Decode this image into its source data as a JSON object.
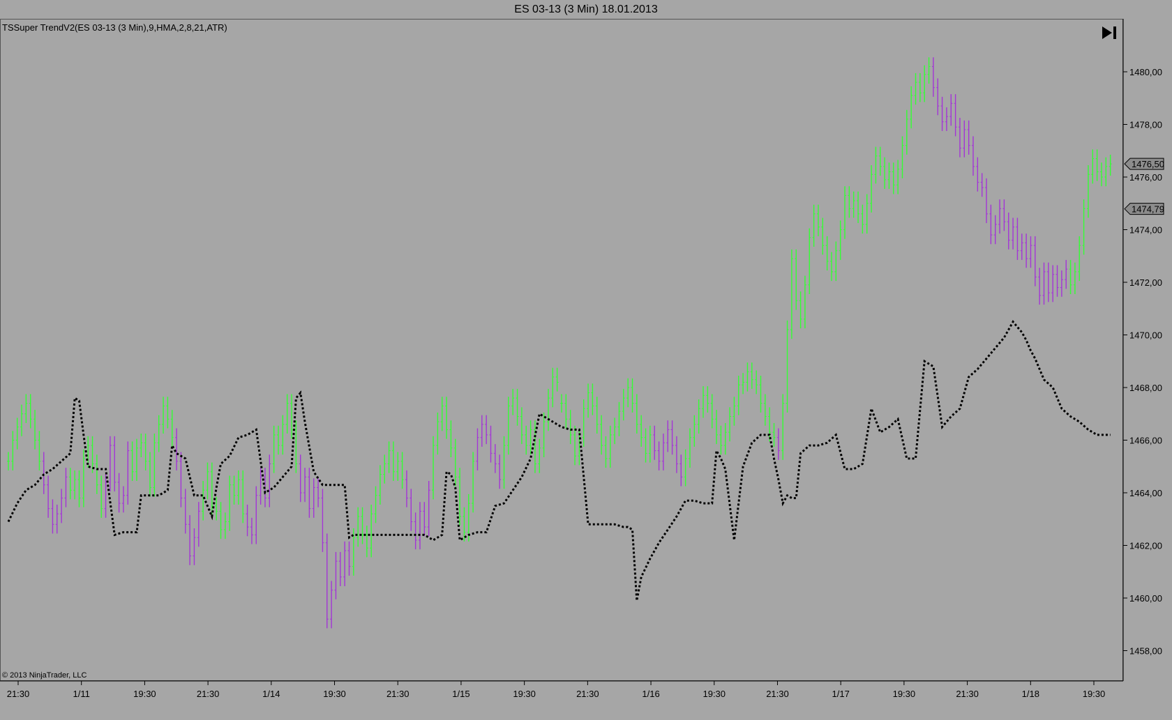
{
  "window": {
    "title": "ES 03-13 (3 Min)  18.01.2013"
  },
  "indicator": {
    "label": "TSSuper TrendV2(ES 03-13 (3 Min),9,HMA,2,8,21,ATR)"
  },
  "footer": {
    "copyright": "© 2013 NinjaTrader, LLC"
  },
  "toolbar": {
    "go_end_icon": "skip-to-end-icon"
  },
  "colors": {
    "up_bar": "#33ff33",
    "down_bar": "#a335d6",
    "trend_line": "#000000",
    "background": "#a6a6a6"
  },
  "chart_data": {
    "type": "line",
    "grid": false,
    "ylim": [
      1457,
      1481.5
    ],
    "yticks": [
      "1480,00",
      "1478,00",
      "1476,00",
      "1474,00",
      "1472,00",
      "1470,00",
      "1468,00",
      "1466,00",
      "1464,00",
      "1462,00",
      "1460,00",
      "1458,00"
    ],
    "xticks": [
      "21:30",
      "1/11",
      "19:30",
      "21:30",
      "1/14",
      "19:30",
      "21:30",
      "1/15",
      "19:30",
      "21:30",
      "1/16",
      "19:30",
      "21:30",
      "1/17",
      "19:30",
      "21:30",
      "1/18",
      "19:30"
    ],
    "price_markers": [
      {
        "label": "1476,50",
        "value": 1476.5
      },
      {
        "label": "1474,79",
        "value": 1474.79
      }
    ],
    "bars": {
      "x": [
        0,
        4,
        8,
        12,
        16,
        20,
        24,
        28,
        32,
        36,
        40,
        44,
        48,
        52,
        56,
        60,
        64,
        68,
        72,
        76,
        80,
        84,
        88,
        92,
        96,
        100,
        104,
        108,
        112,
        116,
        120,
        124,
        128,
        132,
        136,
        140,
        144,
        148,
        152,
        156,
        160,
        164,
        168,
        172,
        176,
        180,
        184,
        188,
        192,
        196,
        200,
        204,
        208,
        212,
        216,
        220,
        224,
        228,
        232,
        236,
        240,
        244,
        248,
        252,
        256,
        260,
        264,
        268,
        272,
        276,
        280,
        284,
        288,
        292,
        296,
        300,
        304,
        308,
        312,
        316,
        320,
        324,
        328,
        332,
        336,
        340,
        344,
        348,
        352,
        356,
        360,
        364,
        368,
        372,
        376,
        380,
        384,
        388,
        392,
        396,
        400,
        404,
        408,
        412,
        416,
        420,
        424,
        428,
        432,
        436,
        440,
        444,
        448,
        452,
        456,
        460,
        464,
        468,
        472,
        476,
        480,
        484,
        488,
        492,
        496
      ],
      "close": [
        1465.2,
        1466,
        1466.5,
        1467,
        1467.4,
        1466.8,
        1466,
        1465.2,
        1464.3,
        1463.4,
        1462.8,
        1463.2,
        1463.8,
        1464.6,
        1464.1,
        1464.5,
        1463.8,
        1465.3,
        1465.8,
        1465.1,
        1464.3,
        1463.4,
        1464.4,
        1465.8,
        1464.4,
        1463.6,
        1463.9,
        1465.6,
        1464.8,
        1465.7,
        1465.9,
        1465.2,
        1464.2,
        1465.9,
        1466.6,
        1467.3,
        1466.8,
        1466.1,
        1465.2,
        1463.8,
        1462.8,
        1461.6,
        1462.3,
        1463.3,
        1464.1,
        1464.8,
        1463.5,
        1463.3,
        1462.6,
        1462.9,
        1464.3,
        1463.9,
        1464.5,
        1463.2,
        1462.7,
        1462.4,
        1463.9,
        1464.6,
        1463.8,
        1465.1,
        1466.2,
        1465.8,
        1466.6,
        1467.4,
        1466.4,
        1465.1,
        1464,
        1464.6,
        1463.4,
        1464.2,
        1463.8,
        1462.1,
        1459.2,
        1460.3,
        1461.4,
        1460.8,
        1461.8,
        1461.2,
        1462.3,
        1463.1,
        1462.4,
        1461.9,
        1463.2,
        1463.9,
        1464.7,
        1465.1,
        1465.6,
        1464.8,
        1465.2,
        1464.5,
        1463.8,
        1462.9,
        1462.2,
        1463.3,
        1462.7,
        1464.1,
        1465.8,
        1466.7,
        1467.3,
        1466.4,
        1465.7,
        1464.6,
        1463.1,
        1462.5,
        1463.6,
        1465.2,
        1466.1,
        1466.6,
        1466.2,
        1465.5,
        1465.1,
        1464.5,
        1465.8,
        1467.3,
        1467.6,
        1466.9,
        1466.2,
        1465.8,
        1466.4,
        1465.1,
        1465.7,
        1466.7,
        1467.6,
        1468.4,
        1468.2
      ],
      "color": [
        "up",
        "up",
        "up",
        "up",
        "up",
        "up",
        "up",
        "up",
        "down",
        "down",
        "down",
        "down",
        "down",
        "down",
        "up",
        "up",
        "up",
        "up",
        "up",
        "up",
        "up",
        "up",
        "down",
        "down",
        "down",
        "down",
        "down",
        "down",
        "up",
        "up",
        "up",
        "up",
        "up",
        "up",
        "up",
        "up",
        "up",
        "up",
        "down",
        "down",
        "down",
        "down",
        "down",
        "down",
        "up",
        "up",
        "up",
        "up",
        "up",
        "up",
        "up",
        "up",
        "up",
        "up",
        "down",
        "down",
        "down",
        "down",
        "down",
        "down",
        "up",
        "up",
        "up",
        "up",
        "up",
        "up",
        "down",
        "down",
        "down",
        "down",
        "down",
        "down",
        "down",
        "down",
        "down",
        "down",
        "down",
        "down",
        "up",
        "up",
        "up",
        "up",
        "up",
        "up",
        "up",
        "up",
        "up",
        "up",
        "up",
        "up",
        "down",
        "down",
        "down",
        "down",
        "down",
        "down",
        "up",
        "up",
        "up",
        "up",
        "up",
        "up",
        "up",
        "up",
        "up",
        "up",
        "down",
        "down",
        "down",
        "down",
        "down",
        "down",
        "up",
        "up",
        "up",
        "up",
        "up",
        "up",
        "up",
        "up",
        "up",
        "up",
        "up",
        "up",
        "up"
      ]
    },
    "bars_part2": {
      "x": [
        500,
        504,
        508,
        512,
        516,
        520,
        524,
        528,
        532,
        536,
        540,
        544,
        548,
        552,
        556,
        560,
        564,
        568,
        572,
        576,
        580,
        584,
        588,
        592,
        596,
        600,
        604,
        608,
        612,
        616,
        620,
        624,
        628,
        632,
        636,
        640,
        644,
        648,
        652,
        656,
        660,
        664,
        668,
        672,
        676,
        680,
        684,
        688,
        692,
        696,
        700,
        704,
        708,
        712,
        716,
        720,
        724,
        728,
        732,
        736,
        740,
        744,
        748,
        752,
        756,
        760,
        764,
        768,
        772,
        776,
        780,
        784,
        788,
        792,
        796,
        800,
        804,
        808,
        812,
        816,
        820,
        824,
        828,
        832,
        836,
        840,
        844,
        848,
        852,
        856,
        860,
        864,
        868,
        872,
        876,
        880,
        884,
        888,
        892,
        896,
        900,
        904,
        908,
        912,
        916,
        920,
        924,
        928,
        932,
        936,
        940,
        944,
        948,
        952,
        956,
        960,
        964,
        968,
        972,
        976,
        980,
        984,
        988,
        992,
        996
      ],
      "close": [
        1467.4,
        1466.8,
        1466.2,
        1465.4,
        1466.1,
        1467.2,
        1467.8,
        1467.3,
        1466.6,
        1465.8,
        1465.3,
        1466.2,
        1466.5,
        1467.1,
        1467.6,
        1468,
        1467.4,
        1466.6,
        1466.1,
        1465.5,
        1466.2,
        1465.6,
        1465.2,
        1465.9,
        1466.4,
        1465.8,
        1465.1,
        1464.6,
        1465.3,
        1466.1,
        1466.6,
        1467.2,
        1467.7,
        1467.4,
        1466.8,
        1466.2,
        1465.8,
        1466.3,
        1466.9,
        1467.3,
        1468.1,
        1468.2,
        1468.6,
        1468.3,
        1468.1,
        1467.4,
        1466.9,
        1466.3,
        1466.1,
        1465.6,
        1467.4,
        1470.2,
        1472.9,
        1471.3,
        1470.6,
        1471.9,
        1473.7,
        1474.6,
        1474.1,
        1473.4,
        1472.8,
        1472.4,
        1473.2,
        1474,
        1475.3,
        1474.8,
        1475.1,
        1474.6,
        1474.2,
        1475,
        1476.1,
        1476.8,
        1476.4,
        1475.9,
        1476.2,
        1475.7,
        1476.3,
        1477.2,
        1478.2,
        1479.1,
        1479.6,
        1479.2,
        1479.9,
        1480.2,
        1479.4,
        1478.7,
        1478.1,
        1478.3,
        1478.8,
        1477.9,
        1477.1,
        1477.8,
        1477.2,
        1476.4,
        1475.8,
        1475.6,
        1474.6,
        1473.8,
        1474.2,
        1474.8,
        1474.3,
        1473.6,
        1474.1,
        1473.2,
        1473.5,
        1472.9,
        1473.4,
        1472.2,
        1471.5,
        1472.4,
        1471.6,
        1472.3,
        1471.8,
        1472.1,
        1472.5,
        1471.9,
        1472.4,
        1473.4,
        1474.8,
        1476.1,
        1476.7,
        1476.2,
        1476,
        1476.4,
        1476.5
      ],
      "color": [
        "up",
        "up",
        "up",
        "up",
        "up",
        "up",
        "up",
        "up",
        "up",
        "up",
        "up",
        "up",
        "up",
        "up",
        "up",
        "up",
        "up",
        "up",
        "up",
        "up",
        "up",
        "down",
        "down",
        "down",
        "down",
        "down",
        "down",
        "down",
        "up",
        "up",
        "up",
        "up",
        "up",
        "up",
        "up",
        "up",
        "up",
        "up",
        "up",
        "up",
        "up",
        "up",
        "up",
        "up",
        "up",
        "up",
        "up",
        "up",
        "up",
        "down",
        "up",
        "up",
        "up",
        "up",
        "up",
        "up",
        "up",
        "up",
        "up",
        "up",
        "up",
        "up",
        "up",
        "up",
        "up",
        "up",
        "up",
        "up",
        "up",
        "up",
        "up",
        "up",
        "up",
        "up",
        "up",
        "up",
        "up",
        "up",
        "up",
        "up",
        "up",
        "up",
        "up",
        "up",
        "down",
        "down",
        "down",
        "down",
        "down",
        "down",
        "down",
        "down",
        "down",
        "down",
        "down",
        "down",
        "down",
        "down",
        "down",
        "down",
        "down",
        "down",
        "down",
        "down",
        "down",
        "down",
        "down",
        "down",
        "down",
        "down",
        "down",
        "down",
        "down",
        "down",
        "down",
        "up",
        "up",
        "up",
        "up",
        "up",
        "up",
        "up",
        "up",
        "up",
        "up"
      ]
    },
    "trend_line": {
      "x": [
        0,
        8,
        16,
        24,
        32,
        40,
        48,
        56,
        60,
        64,
        68,
        72,
        80,
        88,
        96,
        104,
        112,
        116,
        120,
        128,
        136,
        144,
        148,
        152,
        160,
        168,
        176,
        184,
        188,
        192,
        200,
        208,
        216,
        224,
        232,
        240,
        248,
        252,
        256,
        260,
        264,
        268,
        276,
        284,
        292,
        300,
        304,
        308,
        312,
        316,
        320,
        328,
        336,
        344,
        352,
        360,
        368,
        376,
        384,
        392,
        396,
        400,
        404,
        408,
        416,
        424,
        432,
        440,
        448,
        456,
        464,
        472,
        480,
        488,
        496
      ],
      "y": [
        1462.9,
        1463.6,
        1464.1,
        1464.3,
        1464.7,
        1464.9,
        1465.2,
        1465.5,
        1467.6,
        1467.5,
        1466.2,
        1465,
        1464.9,
        1464.9,
        1462.4,
        1462.5,
        1462.5,
        1462.5,
        1463.9,
        1463.9,
        1463.9,
        1464.1,
        1465.8,
        1465.5,
        1465.3,
        1463.9,
        1463.9,
        1463.1,
        1464.2,
        1465.1,
        1465.4,
        1466.1,
        1466.2,
        1466.4,
        1464,
        1464.2,
        1464.6,
        1464.8,
        1465,
        1467.6,
        1467.8,
        1466.7,
        1464.8,
        1464.3,
        1464.3,
        1464.3,
        1464.3,
        1462.3,
        1462.4,
        1462.4,
        1462.4,
        1462.4,
        1462.4,
        1462.4,
        1462.4,
        1462.4,
        1462.4,
        1462.4,
        1462.2,
        1462.4,
        1464.8,
        1464.7,
        1464.2,
        1462.2,
        1462.4,
        1462.5,
        1462.5,
        1463.5,
        1463.6,
        1464.1,
        1464.6,
        1465.3,
        1467,
        1466.8,
        1466.6
      ]
    },
    "trend_line_part2": {
      "x": [
        500,
        508,
        516,
        524,
        532,
        540,
        548,
        556,
        560,
        564,
        568,
        572,
        580,
        588,
        596,
        604,
        612,
        620,
        628,
        636,
        640,
        644,
        648,
        656,
        664,
        672,
        680,
        688,
        692,
        696,
        700,
        704,
        708,
        712,
        716,
        724,
        732,
        740,
        748,
        756,
        764,
        772,
        780,
        788,
        796,
        804,
        812,
        820,
        828,
        836,
        844,
        852,
        860,
        868,
        876,
        884,
        892,
        900,
        908,
        912,
        916,
        920,
        924,
        928,
        936,
        944,
        952,
        960,
        968,
        976,
        984,
        992,
        996
      ],
      "y": [
        1466.5,
        1466.4,
        1466.4,
        1462.8,
        1462.8,
        1462.8,
        1462.8,
        1462.7,
        1462.7,
        1462.6,
        1459.9,
        1460.8,
        1461.5,
        1462.1,
        1462.6,
        1463.1,
        1463.7,
        1463.7,
        1463.6,
        1463.6,
        1465.6,
        1465.3,
        1464.9,
        1462.2,
        1465,
        1465.9,
        1466.2,
        1466.2,
        1465.3,
        1464.5,
        1463.6,
        1463.9,
        1463.8,
        1463.8,
        1465.5,
        1465.8,
        1465.8,
        1465.9,
        1466.2,
        1464.9,
        1464.9,
        1465.1,
        1467.2,
        1466.3,
        1466.5,
        1466.8,
        1465.3,
        1465.3,
        1469,
        1468.8,
        1466.5,
        1466.9,
        1467.2,
        1468.4,
        1468.7,
        1469.1,
        1469.5,
        1469.9,
        1470.5,
        1470.3,
        1470.1,
        1469.8,
        1469.4,
        1469.1,
        1468.3,
        1468,
        1467.2,
        1466.9,
        1466.7,
        1466.4,
        1466.2,
        1466.2,
        1466.2
      ]
    }
  }
}
